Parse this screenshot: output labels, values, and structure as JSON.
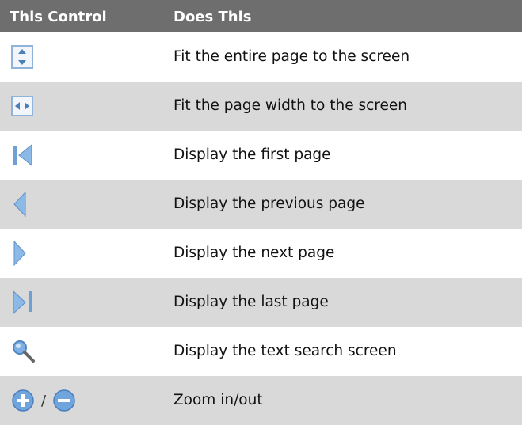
{
  "table": {
    "headers": [
      "This Control",
      "Does This"
    ],
    "rows": [
      {
        "icon": "fit-page-icon",
        "description": "Fit the entire page to the screen"
      },
      {
        "icon": "fit-width-icon",
        "description": "Fit the page width to the screen"
      },
      {
        "icon": "first-page-icon",
        "description": "Display the first page"
      },
      {
        "icon": "previous-page-icon",
        "description": "Display the previous page"
      },
      {
        "icon": "next-page-icon",
        "description": "Display the next page"
      },
      {
        "icon": "last-page-icon",
        "description": "Display the last page"
      },
      {
        "icon": "search-icon",
        "description": "Display the text search screen"
      },
      {
        "icon": "zoom-in-icon",
        "icon2": "zoom-out-icon",
        "separator": "/",
        "description": "Zoom in/out"
      }
    ]
  },
  "colors": {
    "header_bg": "#6e6e6e",
    "row_shade": "#d9d9d9",
    "icon_blue": "#4a90d9"
  }
}
